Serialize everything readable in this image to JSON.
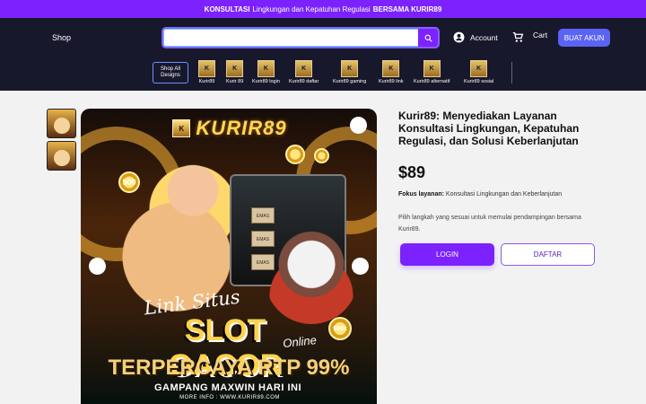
{
  "promo": {
    "left_strong": "KONSULTASI",
    "text": "Lingkungan dan Kepatuhan Regulasi",
    "right_strong": "BERSAMA KURIR89"
  },
  "header": {
    "shop": "Shop",
    "search": {
      "value": "",
      "placeholder": ""
    },
    "account": "Account",
    "cart": "Cart",
    "create_account": "BUAT AKUN",
    "shop_all": "Shop All Designs",
    "nav_items": [
      "Kurir89",
      "Kurir 89",
      "Kurir89 login",
      "Kurir89 daftar",
      "Kurir89 gaming",
      "Kurir89 link",
      "Kurir89 alternatif",
      "Kurir89 sosial"
    ]
  },
  "hero": {
    "logo": "KURIR89",
    "line1": "Link Situs",
    "line2": "SLOT GACOR",
    "line3": "Online",
    "line4": "TERPERCAYA RTP 99%",
    "line5": "GAMPANG MAXWIN HARI INI",
    "line6": "MORE INFO : WWW.KURIR89.COM",
    "coin_500_a": "500",
    "coin_500_b": "500x",
    "tile_label": "EMAS"
  },
  "product": {
    "title": "Kurir89: Menyediakan Layanan Konsultasi Lingkungan, Kepatuhan Regulasi, dan Solusi Keberlanjutan",
    "price": "$89",
    "focus_label": "Fokus layanan:",
    "focus_value": "Konsultasi Lingkungan dan Keberlanjutan",
    "description": "Pilih langkah yang sesuai untuk memulai pendampingan bersama Kurir89.",
    "login": "LOGIN",
    "register": "DAFTAR"
  },
  "colors": {
    "brand": "#7b22ff",
    "header_bg": "#18182c",
    "secondary_button": "#5b63f5"
  },
  "icons": {
    "search": "search-icon",
    "account": "account-icon",
    "cart": "cart-icon"
  }
}
